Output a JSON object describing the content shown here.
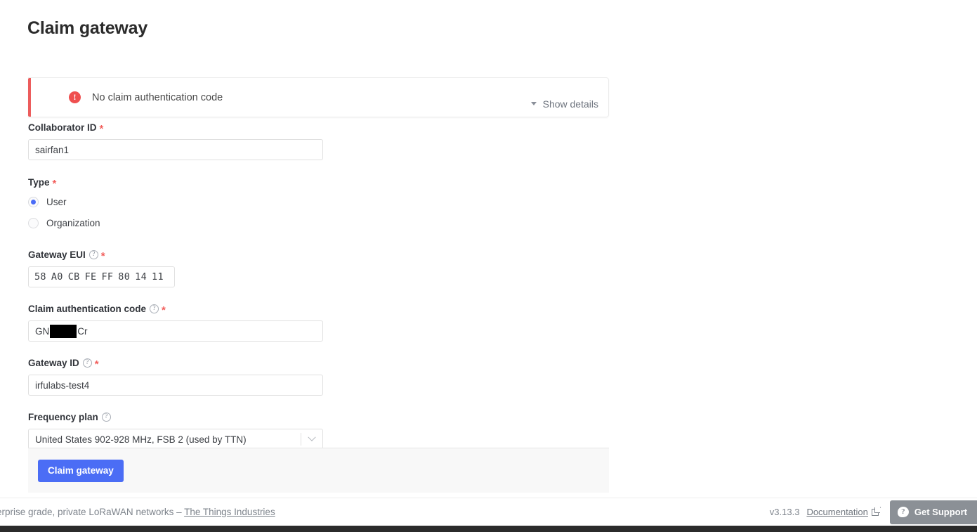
{
  "page": {
    "title": "Claim gateway"
  },
  "alert": {
    "icon": "error-exclamation-icon",
    "message": "No claim authentication code",
    "details_toggle_label": "Show details",
    "details_toggle_icon": "caret-down-icon",
    "accent_color": "#ec5c5c"
  },
  "form": {
    "collaborator_id": {
      "label": "Collaborator ID",
      "required_marker": "*",
      "value": "sairfan1"
    },
    "type": {
      "label": "Type",
      "required_marker": "*",
      "options": [
        {
          "label": "User",
          "selected": true
        },
        {
          "label": "Organization",
          "selected": false
        }
      ]
    },
    "gateway_eui": {
      "label": "Gateway EUI",
      "required_marker": "*",
      "help_icon": "help-circle-icon",
      "bytes": [
        "58",
        "A0",
        "CB",
        "FE",
        "FF",
        "80",
        "14",
        "11"
      ]
    },
    "claim_authentication_code": {
      "label": "Claim authentication code",
      "required_marker": "*",
      "help_icon": "help-circle-icon",
      "value_prefix": "GN",
      "value_suffix": "Cr",
      "redacted": true
    },
    "gateway_id": {
      "label": "Gateway ID",
      "required_marker": "*",
      "help_icon": "help-circle-icon",
      "value": "irfulabs-test4"
    },
    "frequency_plan": {
      "label": "Frequency plan",
      "help_icon": "help-circle-icon",
      "selected": "United States 902-928 MHz, FSB 2 (used by TTN)",
      "dropdown_icon": "chevron-down-icon"
    },
    "submit": {
      "label": "Claim gateway",
      "color": "#4b6df5"
    }
  },
  "footer": {
    "tagline": "erprise grade, private LoRaWAN networks – ",
    "tagline_link": "The Things Industries",
    "version": "v3.13.3",
    "documentation_label": "Documentation",
    "documentation_icon": "external-link-icon",
    "support_label": "Get Support",
    "support_icon": "question-chat-icon"
  }
}
